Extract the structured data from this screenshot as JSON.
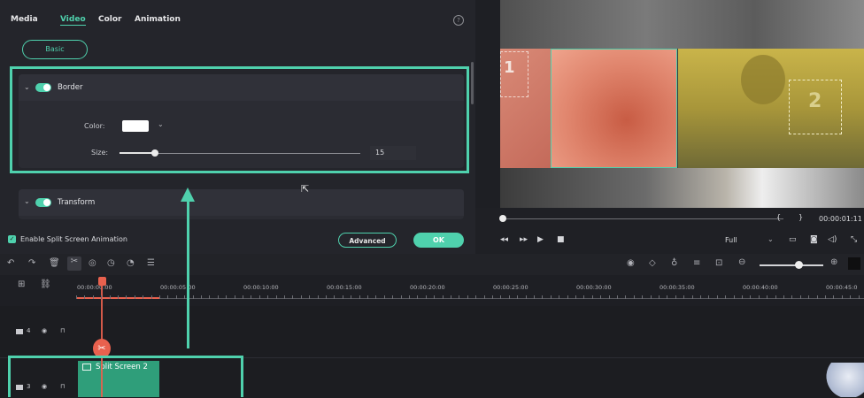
{
  "editor": {
    "tabs": [
      "Media",
      "Video",
      "Color",
      "Animation"
    ],
    "active_tab": "Video",
    "help_glyph": "?",
    "basic_button": "Basic",
    "border": {
      "title": "Border",
      "color_label": "Color:",
      "color_value": "#ffffff",
      "size_label": "Size:",
      "size_value": "15"
    },
    "transform": {
      "title": "Transform"
    },
    "enable_label": "Enable Split Screen Animation",
    "advanced_button": "Advanced",
    "ok_button": "OK"
  },
  "preview": {
    "timecode": "00:00:01:11",
    "braces_left": "{",
    "braces_right": "}",
    "zoom_select": "Full",
    "overlay_numbers": [
      "1",
      "2"
    ]
  },
  "timeline": {
    "ruler": [
      "00:00:00:00",
      "00:00:05:00",
      "00:00:10:00",
      "00:00:15:00",
      "00:00:20:00",
      "00:00:25:00",
      "00:00:30:00",
      "00:00:35:00",
      "00:00:40:00",
      "00:00:45:0"
    ],
    "tracks": [
      {
        "number": "4"
      },
      {
        "number": "3"
      }
    ],
    "clip_label": "Split Screen 2"
  },
  "colors": {
    "accent": "#4fd1ad",
    "playhead": "#e8614e",
    "clip": "#2f9e7a"
  }
}
